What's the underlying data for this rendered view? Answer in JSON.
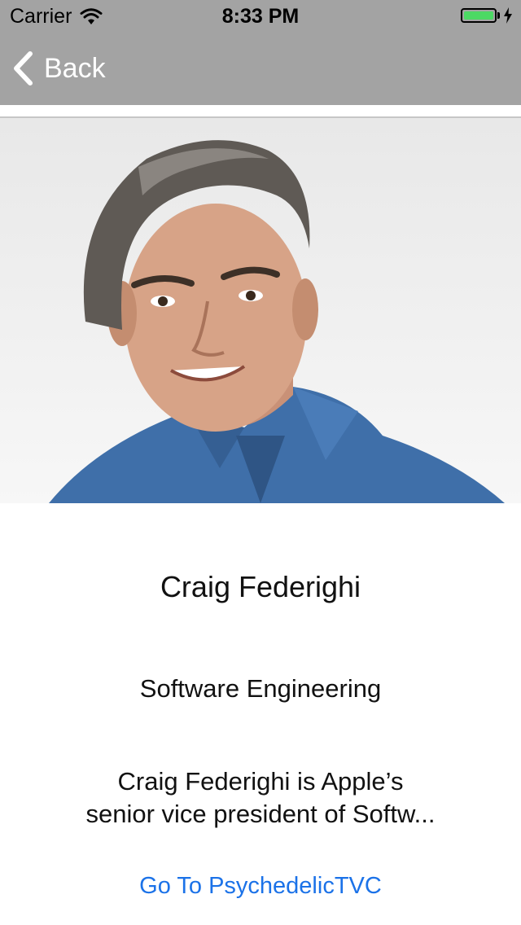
{
  "status_bar": {
    "carrier": "Carrier",
    "time": "8:33 PM",
    "battery_level": 1.0,
    "battery_color": "#4cd964"
  },
  "nav": {
    "back_label": "Back",
    "bar_color": "#a3a3a3"
  },
  "profile": {
    "photo_icon": "portrait-photo",
    "name": "Craig Federighi",
    "department": "Software Engineering",
    "bio_line1": "Craig Federighi is Apple’s",
    "bio_line2": "senior vice president of Softw..."
  },
  "actions": {
    "go_link": "Go To PsychedelicTVC",
    "link_color": "#1b72e8"
  }
}
